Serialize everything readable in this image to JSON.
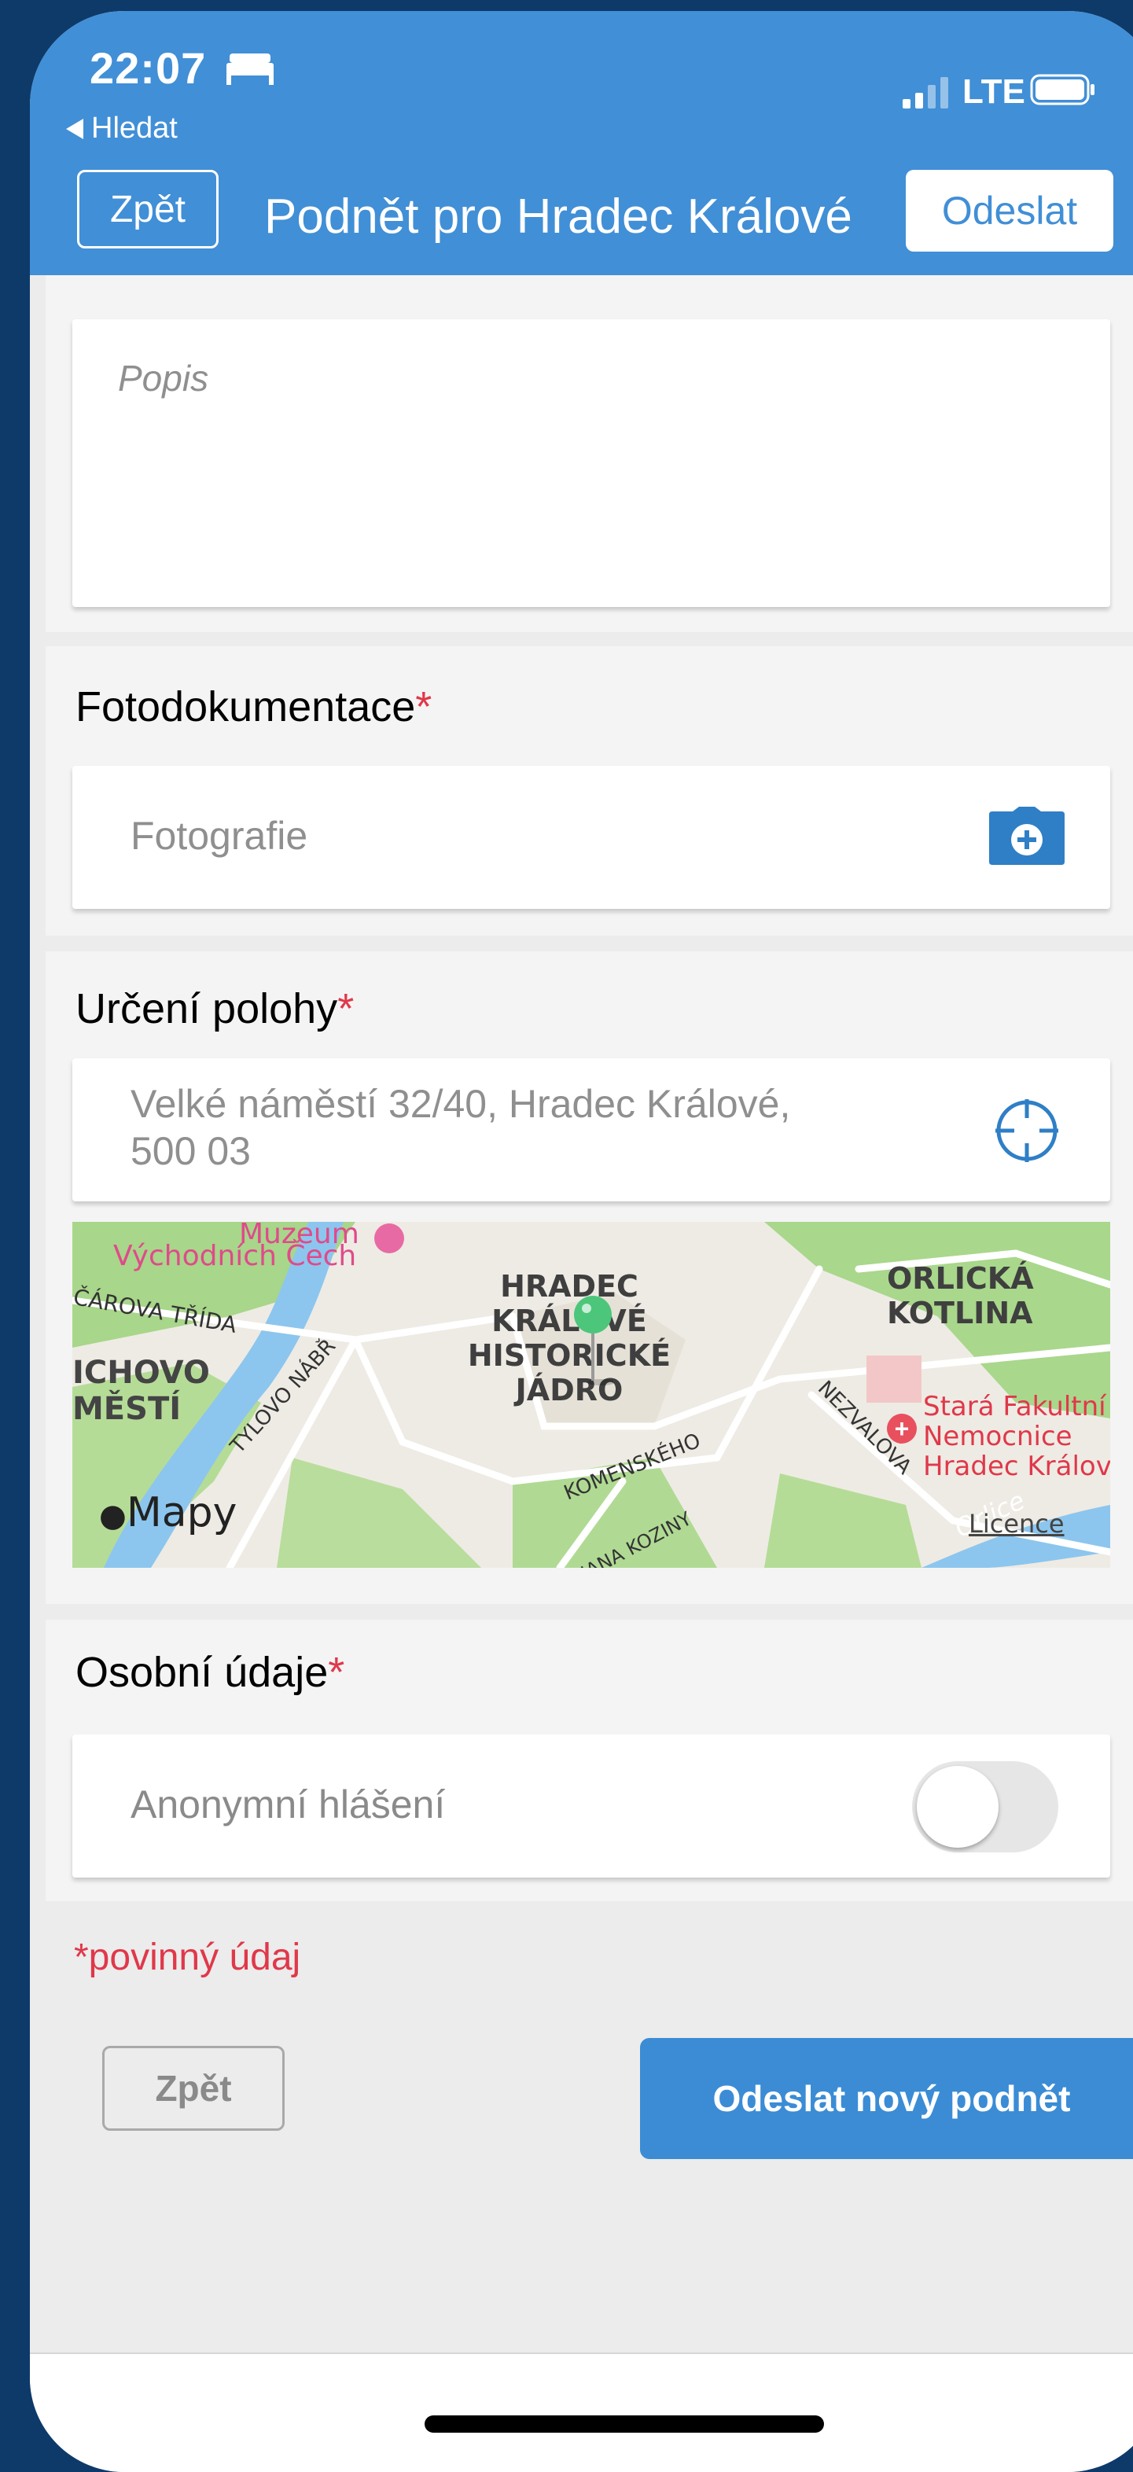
{
  "status_bar": {
    "time": "22:07",
    "network": "LTE",
    "back_app": "Hledat"
  },
  "nav": {
    "back_label": "Zpět",
    "title": "Podnět pro Hradec Králové",
    "send_label": "Odeslat"
  },
  "description": {
    "placeholder": "Popis"
  },
  "photos": {
    "title": "Fotodokumentace",
    "required_mark": "*",
    "placeholder": "Fotografie",
    "icon": "camera-add-icon"
  },
  "location": {
    "title": "Určení polohy",
    "required_mark": "*",
    "address_line1": "Velké náměstí 32/40, Hradec Králové,",
    "address_line2": "500 03",
    "icon": "crosshair-icon"
  },
  "map": {
    "museum_line1": "Muzeum",
    "museum_line2": "Východních Čech",
    "labels": [
      "HRADEC",
      "KRÁLOVÉ",
      "HISTORICKÉ",
      "JÁDRO"
    ],
    "orlicka": [
      "ORLICKÁ",
      "KOTLINA"
    ],
    "left_labels": [
      "ICHOVO",
      "MĚSTÍ"
    ],
    "street_carova": "ČÁROVA TŘÍDA",
    "street_tylovo": "TYLOVO NÁBŘ",
    "street_komenskeho": "KOMENSKÉHO",
    "street_nezvalova": "NEZVALOVA",
    "street_kozina": "JANA KOZINY",
    "river": "Orlice",
    "hospital": [
      "Stará Fakultní",
      "Nemocnice",
      "Hradec Králové"
    ],
    "brand": "Mapy",
    "licence": "Licence"
  },
  "personal": {
    "title": "Osobní údaje",
    "required_mark": "*",
    "anonymous_label": "Anonymní hlášení",
    "anonymous_on": false
  },
  "required_note": "*povinný údaj",
  "footer": {
    "back_label": "Zpět",
    "submit_label": "Odeslat nový podnět"
  },
  "colors": {
    "brand": "#418fd6",
    "required": "#e0384a"
  }
}
